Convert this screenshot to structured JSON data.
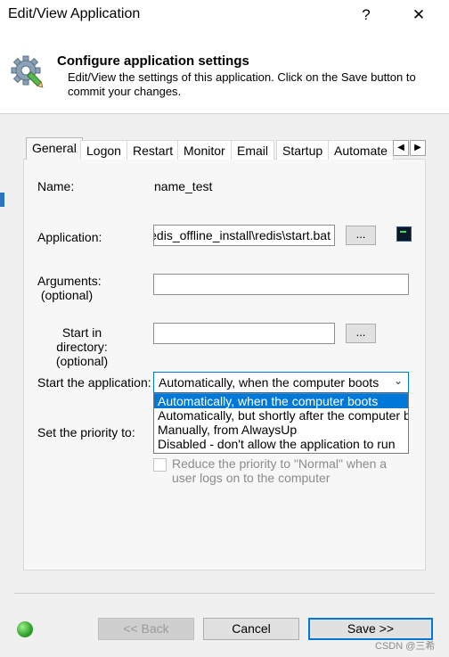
{
  "window": {
    "title": "Edit/View Application",
    "help_label": "?",
    "close_label": "✕"
  },
  "header": {
    "title": "Configure application settings",
    "description": "Edit/View the settings of this application. Click on the Save button to commit your changes."
  },
  "tabs": [
    {
      "label": "General",
      "active": true
    },
    {
      "label": "Logon"
    },
    {
      "label": "Restart"
    },
    {
      "label": "Monitor"
    },
    {
      "label": "Email"
    },
    {
      "label": "Startup"
    },
    {
      "label": "Automate"
    }
  ],
  "tab_scroll": {
    "left": "◀",
    "right": "▶"
  },
  "form": {
    "name_label": "Name:",
    "name_value": "name_test",
    "application_label": "Application:",
    "application_value": "redis_offline_install\\redis\\start.bat",
    "browse_label": "...",
    "arguments_label": "Arguments:",
    "arguments_optional": "(optional)",
    "arguments_value": "",
    "start_dir_label": "Start in directory:",
    "start_dir_optional": "(optional)",
    "start_dir_value": "",
    "start_app_label": "Start the application:",
    "start_app_selected": "Automatically, when the computer boots",
    "start_app_options": [
      "Automatically, when the computer boots",
      "Automatically, but shortly after the computer boots",
      "Manually, from AlwaysUp",
      "Disabled - don't allow the application to run"
    ],
    "priority_label": "Set the priority to:",
    "reduce_priority_label": "Reduce the priority to \"Normal\" when a user logs on to the computer"
  },
  "footer": {
    "back_label": "<< Back",
    "cancel_label": "Cancel",
    "save_label": "Save >>",
    "status_color": "#2ea12a"
  },
  "watermark": "CSDN @三希"
}
